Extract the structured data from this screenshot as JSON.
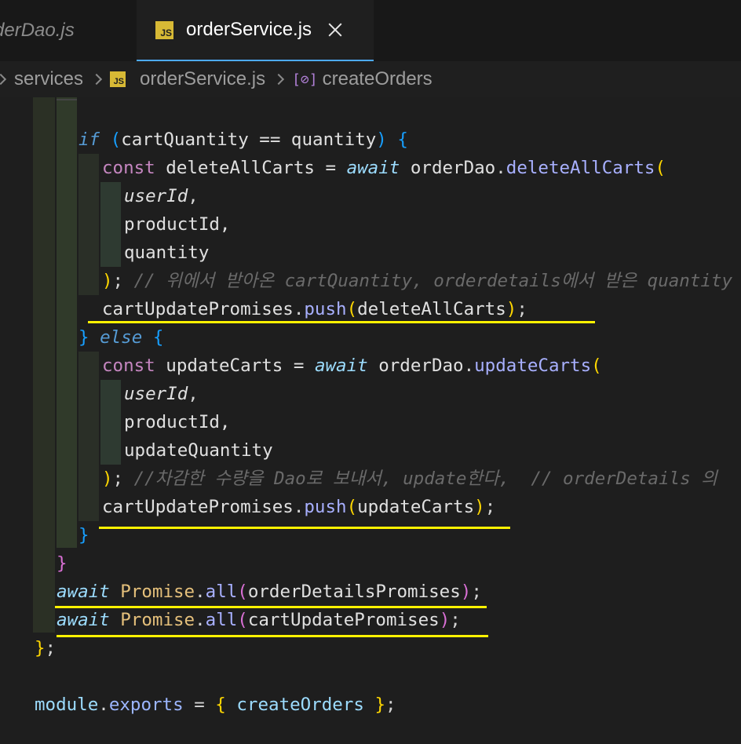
{
  "tabs": [
    {
      "label": "derDao.js",
      "active": false
    },
    {
      "label": "orderService.js",
      "active": true,
      "badge": "JS"
    }
  ],
  "breadcrumb": {
    "items": [
      "services",
      "orderService.js",
      "createOrders"
    ],
    "badge": "JS",
    "symbol_icon": "[⊘]"
  },
  "code": {
    "lines": {
      "l1": {
        "if": "if",
        "open": " (",
        "cond": "cartQuantity == quantity",
        "close": ")",
        "brace": " {"
      },
      "l2": {
        "const": "const",
        "name": " deleteAllCarts = ",
        "await": "await",
        "obj": " orderDao",
        "dot": ".",
        "fn": "deleteAllCarts",
        "paren": "("
      },
      "l3": {
        "text": "userId",
        "comma": ","
      },
      "l4": {
        "text": "productId,"
      },
      "l5": {
        "text": "quantity"
      },
      "l6": {
        "close": ")",
        "semi": "; ",
        "comment": "// 위에서 받아온 cartQuantity, orderdetails에서 받은 quantity"
      },
      "l7": {
        "obj": "cartUpdatePromises",
        "dot": ".",
        "fn": "push",
        "open": "(",
        "arg": "deleteAllCarts",
        "close": ")",
        "semi": ";"
      },
      "l8": {
        "brace": "}",
        "else": " else",
        "open": " {"
      },
      "l9": {
        "const": "const",
        "name": " updateCarts = ",
        "await": "await",
        "obj": " orderDao",
        "dot": ".",
        "fn": "updateCarts",
        "paren": "("
      },
      "l10": {
        "text": "userId",
        "comma": ","
      },
      "l11": {
        "text": "productId,"
      },
      "l12": {
        "text": "updateQuantity"
      },
      "l13": {
        "close": ")",
        "semi": "; ",
        "comment": "//차감한 수량을 Dao로 보내서, update한다,  // orderDetails 의"
      },
      "l14": {
        "obj": "cartUpdatePromises",
        "dot": ".",
        "fn": "push",
        "open": "(",
        "arg": "updateCarts",
        "close": ")",
        "semi": ";"
      },
      "l15": {
        "brace": "}"
      },
      "l16": {
        "brace": "}"
      },
      "l17": {
        "await": "await",
        "cls": " Promise",
        "dot": ".",
        "fn": "all",
        "open": "(",
        "arg": "orderDetailsPromises",
        "close": ")",
        "semi": ";"
      },
      "l18": {
        "await": "await",
        "cls": " Promise",
        "dot": ".",
        "fn": "all",
        "open": "(",
        "arg": "cartUpdatePromises",
        "close": ")",
        "semi": ";"
      },
      "l19": {
        "brace": "}",
        "semi": ";"
      },
      "l20": {
        "mod": "module",
        "dot": ".",
        "exports": "exports",
        "eq": " = ",
        "open": "{ ",
        "name": "createOrders",
        "close": " }",
        "semi": ";"
      }
    }
  },
  "colors": {
    "highlight": "#fff200",
    "background": "#1e1e1e",
    "js_badge": "#d7b935"
  }
}
